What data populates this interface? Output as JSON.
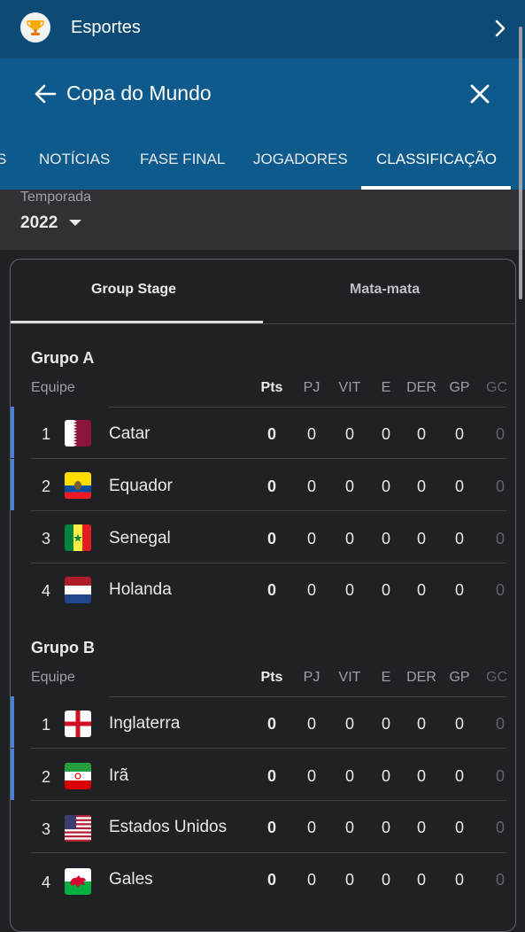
{
  "app": {
    "title": "Esportes",
    "icon": "trophy-icon"
  },
  "page": {
    "title": "Copa do Mundo"
  },
  "tabs": [
    "S",
    "NOTÍCIAS",
    "FASE FINAL",
    "JOGADORES",
    "CLASSIFICAÇÃO"
  ],
  "season": {
    "label": "Temporada",
    "value": "2022"
  },
  "subtabs": [
    "Group Stage",
    "Mata-mata"
  ],
  "columns": {
    "team": "Equipe",
    "pts": "Pts",
    "pj": "PJ",
    "vit": "VIT",
    "e": "E",
    "der": "DER",
    "gp": "GP",
    "gc": "GC"
  },
  "groups": [
    {
      "name": "Grupo A",
      "teams": [
        {
          "rank": "1",
          "name": "Catar",
          "flag": "qatar-flag",
          "pts": "0",
          "pj": "0",
          "vit": "0",
          "e": "0",
          "der": "0",
          "gp": "0",
          "gc": "0"
        },
        {
          "rank": "2",
          "name": "Equador",
          "flag": "ecuador-flag",
          "pts": "0",
          "pj": "0",
          "vit": "0",
          "e": "0",
          "der": "0",
          "gp": "0",
          "gc": "0"
        },
        {
          "rank": "3",
          "name": "Senegal",
          "flag": "senegal-flag",
          "pts": "0",
          "pj": "0",
          "vit": "0",
          "e": "0",
          "der": "0",
          "gp": "0",
          "gc": "0"
        },
        {
          "rank": "4",
          "name": "Holanda",
          "flag": "netherlands-flag",
          "pts": "0",
          "pj": "0",
          "vit": "0",
          "e": "0",
          "der": "0",
          "gp": "0",
          "gc": "0"
        }
      ]
    },
    {
      "name": "Grupo B",
      "teams": [
        {
          "rank": "1",
          "name": "Inglaterra",
          "flag": "england-flag",
          "pts": "0",
          "pj": "0",
          "vit": "0",
          "e": "0",
          "der": "0",
          "gp": "0",
          "gc": "0"
        },
        {
          "rank": "2",
          "name": "Irã",
          "flag": "iran-flag",
          "pts": "0",
          "pj": "0",
          "vit": "0",
          "e": "0",
          "der": "0",
          "gp": "0",
          "gc": "0"
        },
        {
          "rank": "3",
          "name": "Estados Unidos",
          "flag": "usa-flag",
          "pts": "0",
          "pj": "0",
          "vit": "0",
          "e": "0",
          "der": "0",
          "gp": "0",
          "gc": "0"
        },
        {
          "rank": "4",
          "name": "Gales",
          "flag": "wales-flag",
          "pts": "0",
          "pj": "0",
          "vit": "0",
          "e": "0",
          "der": "0",
          "gp": "0",
          "gc": "0"
        }
      ]
    }
  ],
  "colors": {
    "topbar": "#0d4a76",
    "header": "#0e5a8c",
    "background": "#202124",
    "qualified_marker": "#4a80d6"
  }
}
